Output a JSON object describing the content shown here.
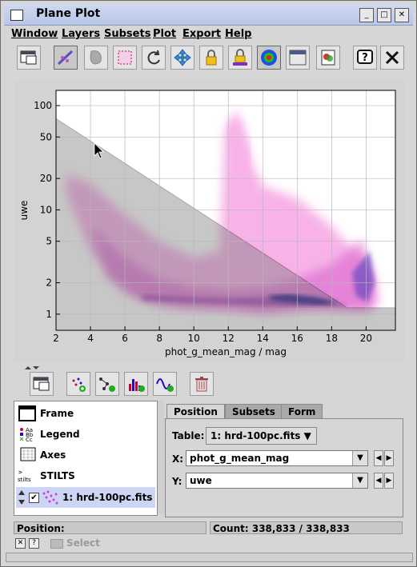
{
  "window": {
    "title": "Plane Plot"
  },
  "menu": [
    "Window",
    "Layers",
    "Subsets",
    "Plot",
    "Export",
    "Help"
  ],
  "toolbar_icons": [
    "window-icon",
    "blob-subset-icon",
    "blob-region-icon",
    "zoom-box-icon",
    "replot-icon",
    "navigate-icon",
    "lock-axes-icon",
    "lock-aux-icon",
    "density-icon",
    "sketch-icon",
    "export-image-icon",
    "help-icon",
    "close-icon"
  ],
  "layer_toolbar_icons": [
    "window-icon",
    "add-position-layer-icon",
    "add-pair-layer-icon",
    "add-histogram-layer-icon",
    "add-function-layer-icon",
    "delete-layer-icon"
  ],
  "chart_data": {
    "type": "scatter",
    "xlabel": "phot_g_mean_mag / mag",
    "ylabel": "uwe",
    "xlim": [
      2,
      21.7
    ],
    "ylim": [
      0.7,
      140
    ],
    "yscale": "log",
    "x_ticks": [
      "2",
      "4",
      "6",
      "8",
      "10",
      "12",
      "14",
      "16",
      "18",
      "20"
    ],
    "y_ticks": [
      "1",
      "2",
      "5",
      "10",
      "20",
      "50",
      "100"
    ],
    "grid": true,
    "description": "density map of sources, pink to dark blue",
    "selection_polygon": {
      "x": [
        2,
        2,
        18.9,
        21.7,
        21.7
      ],
      "y": [
        0.7,
        75,
        1.15,
        1.15,
        0.7
      ]
    }
  },
  "layers": {
    "items": [
      {
        "label": "Frame",
        "icon": "frame-icon"
      },
      {
        "label": "Legend",
        "icon": "legend-icon"
      },
      {
        "label": "Axes",
        "icon": "axes-icon"
      },
      {
        "label": "STILTS",
        "icon": "stilts-icon"
      },
      {
        "label": "1: hrd-100pc.fits",
        "icon": "scatter-layer-icon",
        "checked": true
      }
    ]
  },
  "tabs": [
    "Position",
    "Subsets",
    "Form"
  ],
  "position": {
    "table_label": "Table:",
    "table_value": "1: hrd-100pc.fits",
    "x_label": "X:",
    "x_value": "phot_g_mean_mag",
    "y_label": "Y:",
    "y_value": "uwe"
  },
  "status": {
    "position_label": "Position:",
    "count_label": "Count: 338,833 / 338,833"
  },
  "bottom": {
    "select_label": "Select"
  }
}
